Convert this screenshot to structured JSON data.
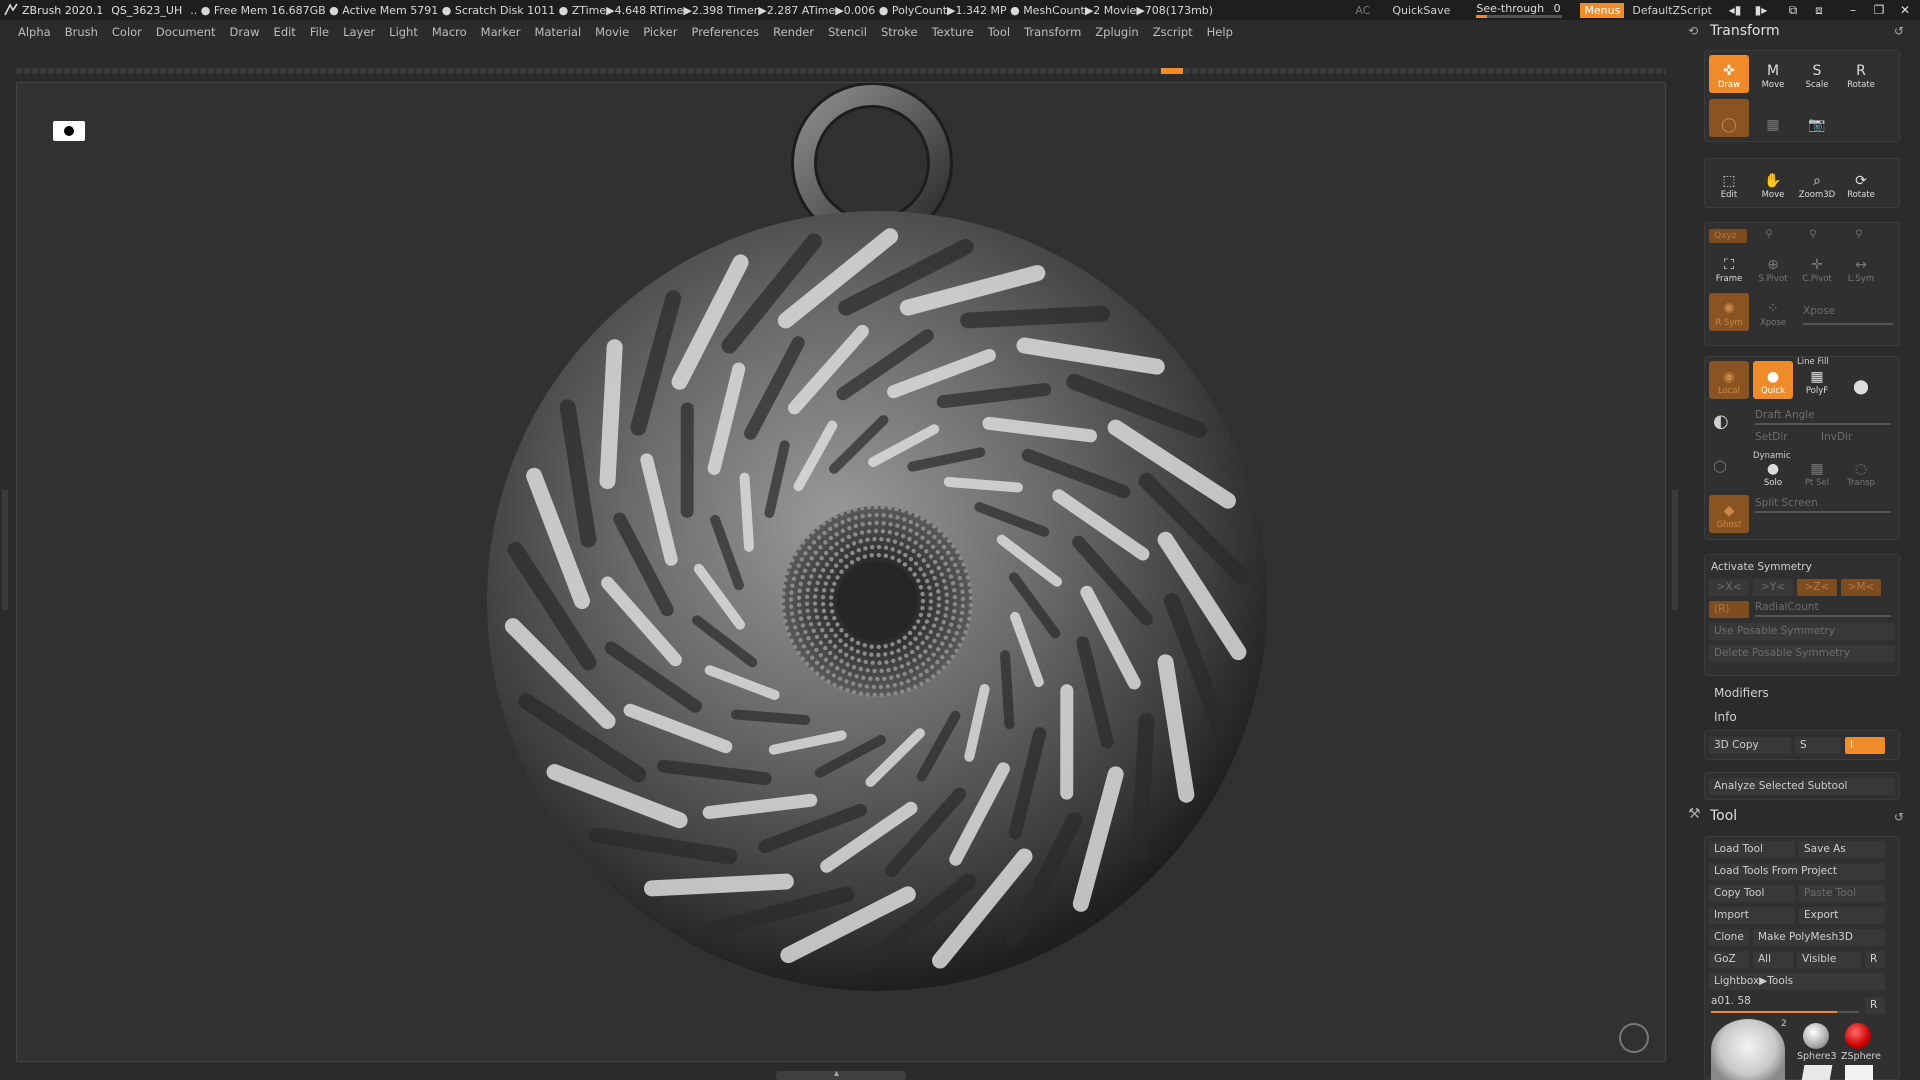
{
  "title_bar": {
    "app_name": "ZBrush 2020.1",
    "document": "QS_3623_UH",
    "stats": ".. ● Free Mem 16.687GB ● Active Mem 5791 ● Scratch Disk 1011 ● ZTime▶4.648 RTime▶2.398 Timer▶2.287 ATime▶0.006 ● PolyCount▶1.342 MP ● MeshCount▶2 Movie▶708(173mb)",
    "ac": "AC",
    "quicksave": "QuickSave",
    "see_through_label": "See-through",
    "see_through_value": "0",
    "see_through_fraction": 0.12,
    "menus_button": "Menus",
    "default_zscript": "DefaultZScript",
    "accent_color": "#f08b2a"
  },
  "menu_bar": {
    "items": [
      "Alpha",
      "Brush",
      "Color",
      "Document",
      "Draw",
      "Edit",
      "File",
      "Layer",
      "Light",
      "Macro",
      "Marker",
      "Material",
      "Movie",
      "Picker",
      "Preferences",
      "Render",
      "Stencil",
      "Stroke",
      "Texture",
      "Tool",
      "Transform",
      "Zplugin",
      "Zscript",
      "Help"
    ]
  },
  "transform_panel": {
    "title": "Transform",
    "edit_tools": [
      "Draw",
      "Move",
      "Scale",
      "Rotate"
    ],
    "nav_tools": [
      "Edit",
      "Move",
      "Zoom3D",
      "Rotate"
    ],
    "xyz_label": "Qxyz",
    "frame_tools": [
      "Frame",
      "S.Pivot",
      "C.Pivot",
      "L.Sym"
    ],
    "sym_tools": [
      "R Sym",
      "Xpose"
    ],
    "xpose_label": "Xpose",
    "poly_tools": [
      "Local",
      "Quick",
      "PolyF"
    ],
    "line_fill_label": "Line Fill",
    "draft_angle_label": "Draft Angle",
    "setdir_label": "SetDir",
    "invdir_label": "InvDir",
    "dynamic_label": "Dynamic",
    "solo_label": "Solo",
    "ptsel_label": "Pt Sel",
    "transp_label": "Transp",
    "ghost_label": "Ghost",
    "split_screen_label": "Split Screen",
    "activate_symmetry": "Activate Symmetry",
    "sym_axes": [
      ">X<",
      ">Y<",
      ">Z<",
      ">M<"
    ],
    "radial_r": "(R)",
    "radial_count": "RadialCount",
    "use_posable_symmetry": "Use Posable Symmetry",
    "delete_posable_symmetry": "Delete Posable Symmetry",
    "modifiers": "Modifiers",
    "info": "Info",
    "copy_3d": "3D Copy",
    "copy_s": "S",
    "copy_i": "I",
    "analyze_subtool": "Analyze Selected Subtool"
  },
  "tool_panel": {
    "title": "Tool",
    "load_tool": "Load Tool",
    "save_as": "Save As",
    "load_tools_from_project": "Load Tools From Project",
    "copy_tool": "Copy Tool",
    "paste_tool": "Paste Tool",
    "import": "Import",
    "export": "Export",
    "clone": "Clone",
    "make_polymesh": "Make PolyMesh3D",
    "goz": "GoZ",
    "all": "All",
    "visible": "Visible",
    "r": "R",
    "lightbox_tools": "Lightbox▶Tools",
    "current_tool": "a01. 58",
    "current_tool_slider": 0.85,
    "thumb_count": "2",
    "thumbs": [
      "Sphere3",
      "ZSphere"
    ]
  }
}
